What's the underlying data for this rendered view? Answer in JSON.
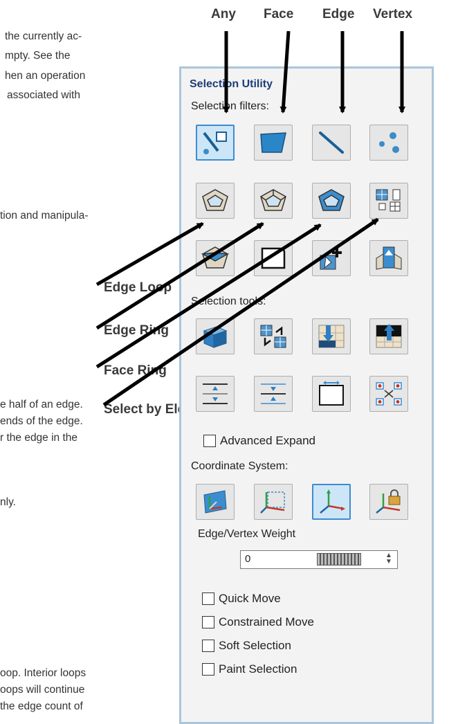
{
  "doc": {
    "lines": [
      "the currently ac-",
      "mpty. See the",
      "hen an operation",
      "associated with",
      "tion and manipula-",
      "e half of an edge.",
      "ends of the edge.",
      "r the edge in the",
      "nly.",
      "oop. Interior loops",
      "oops will continue",
      "the edge count of"
    ]
  },
  "callouts": {
    "top": [
      "Any",
      "Face",
      "Edge",
      "Vertex"
    ],
    "left": [
      "Edge Loop",
      "Edge Ring",
      "Face Ring",
      "Select by Element"
    ]
  },
  "panel": {
    "title": "Selection Utility",
    "filters_label": "Selection filters:",
    "filter_buttons": [
      {
        "icon": "any-filter-icon",
        "active": true
      },
      {
        "icon": "face-filter-icon",
        "active": false
      },
      {
        "icon": "edge-filter-icon",
        "active": false
      },
      {
        "icon": "vertex-filter-icon",
        "active": false
      },
      {
        "icon": "edge-loop-icon",
        "active": false
      },
      {
        "icon": "edge-ring-icon",
        "active": false
      },
      {
        "icon": "face-ring-icon",
        "active": false
      },
      {
        "icon": "select-by-element-icon",
        "active": false
      },
      {
        "icon": "face-loop-icon",
        "active": false
      },
      {
        "icon": "boundary-edge-icon",
        "active": false
      },
      {
        "icon": "add-selection-icon",
        "active": false
      },
      {
        "icon": "extrude-region-icon",
        "active": false
      }
    ],
    "tools_label": "Selection tools:",
    "tool_buttons": [
      {
        "icon": "select-all-cube-icon"
      },
      {
        "icon": "invert-selection-icon"
      },
      {
        "icon": "grow-down-icon"
      },
      {
        "icon": "grow-up-icon"
      },
      {
        "icon": "expand-selection-icon"
      },
      {
        "icon": "shrink-selection-icon"
      },
      {
        "icon": "boundary-select-icon"
      },
      {
        "icon": "scatter-select-icon"
      }
    ],
    "advanced_expand": "Advanced Expand",
    "coord_label": "Coordinate System:",
    "coord_buttons": [
      {
        "icon": "local-coordinate-icon",
        "active": false
      },
      {
        "icon": "bounding-coordinate-icon",
        "active": false
      },
      {
        "icon": "world-coordinate-icon",
        "active": true
      },
      {
        "icon": "locked-coordinate-icon",
        "active": false
      }
    ],
    "weight_label": "Edge/Vertex Weight",
    "weight_value": "0",
    "options": [
      "Quick Move",
      "Constrained Move",
      "Soft Selection",
      "Paint Selection"
    ]
  }
}
